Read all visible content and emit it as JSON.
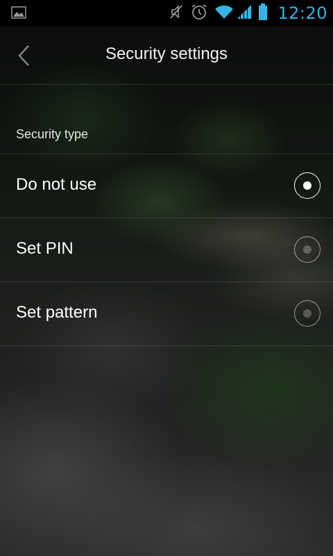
{
  "status_bar": {
    "time": "12:20",
    "icons": [
      "image-notification-icon",
      "mute-icon",
      "alarm-icon",
      "wifi-icon",
      "signal-icon",
      "battery-icon"
    ],
    "accent_color": "#33b5e5"
  },
  "header": {
    "title": "Security settings",
    "back_icon": "chevron-left-icon"
  },
  "section": {
    "title": "Security type"
  },
  "options": [
    {
      "label": "Do not use",
      "selected": true
    },
    {
      "label": "Set PIN",
      "selected": false
    },
    {
      "label": "Set pattern",
      "selected": false
    }
  ]
}
